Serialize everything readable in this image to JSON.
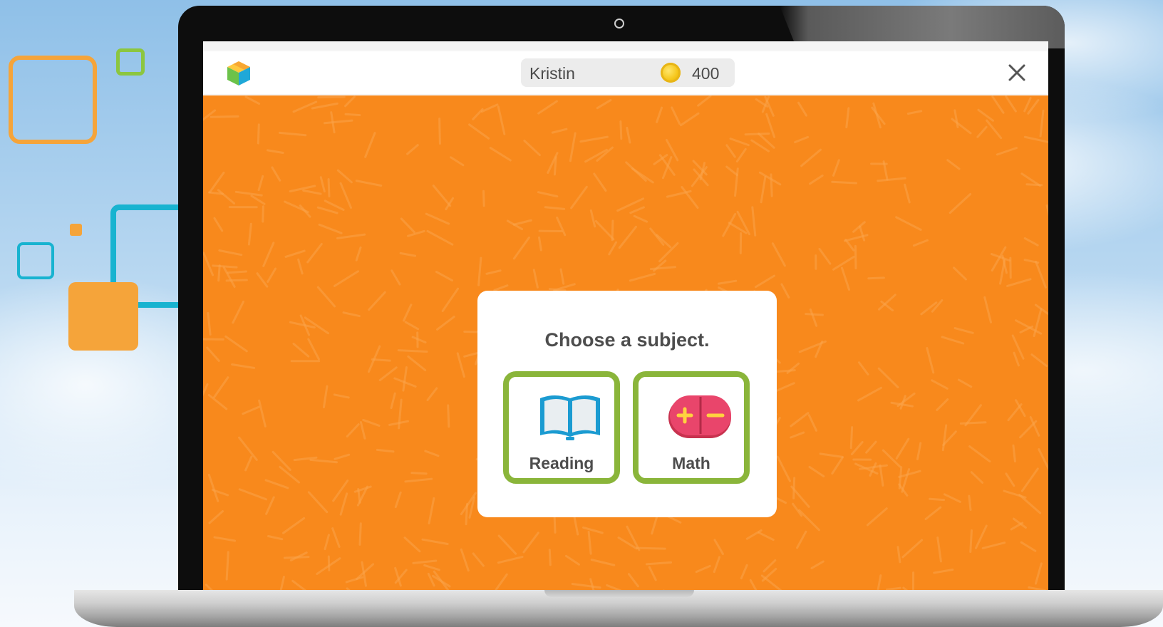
{
  "header": {
    "user_name": "Kristin",
    "coin_count": "400",
    "close_symbol": "✕"
  },
  "dialog": {
    "title": "Choose a subject.",
    "subjects": [
      {
        "label": "Reading",
        "icon": "open-book-icon"
      },
      {
        "label": "Math",
        "icon": "plus-minus-icon"
      }
    ]
  },
  "colors": {
    "background_orange": "#f8891c",
    "selection_green": "#8ab53a",
    "deco_orange": "#f5a43a",
    "deco_teal": "#18b3d0",
    "deco_green": "#8cc63f",
    "coin_gold": "#f5c518",
    "math_icon_red": "#e9456b",
    "book_icon_blue": "#1b9bd1"
  }
}
